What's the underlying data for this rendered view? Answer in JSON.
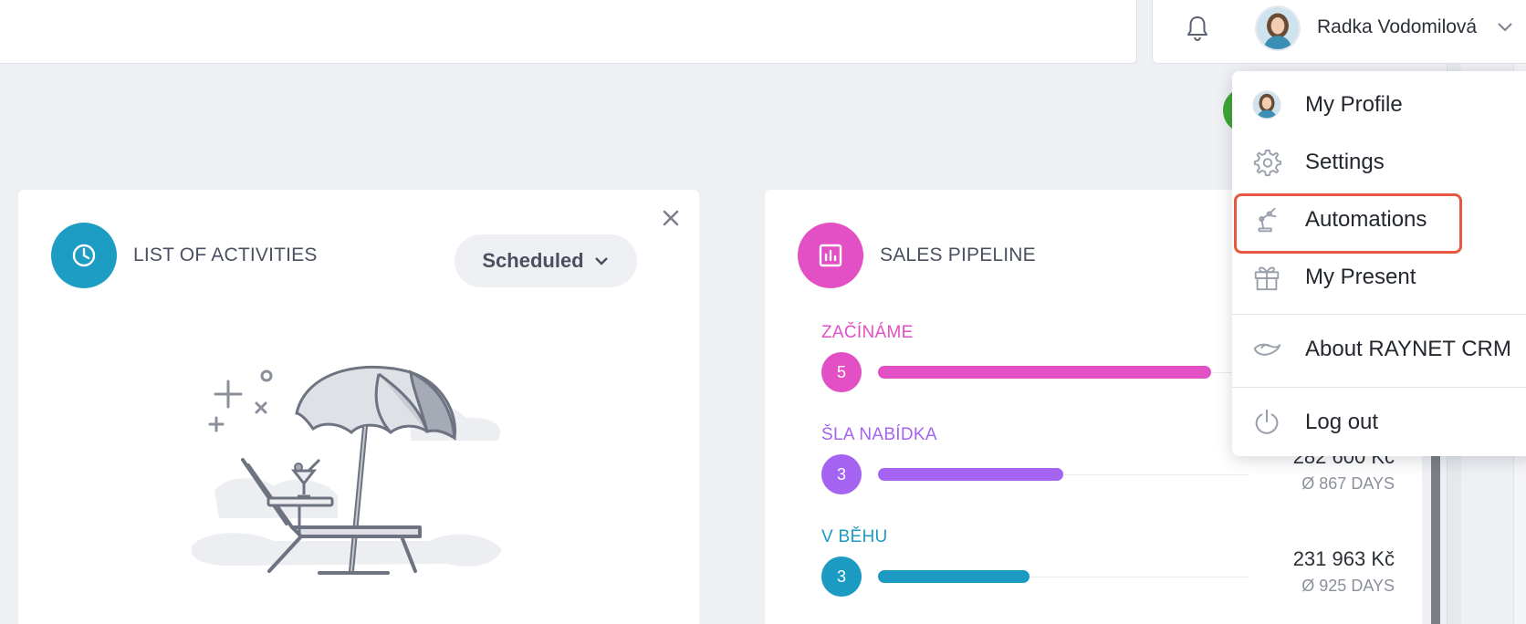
{
  "header": {
    "user_name": "Radka Vodomilová",
    "icons": [
      "bell-icon",
      "avatar",
      "chevron-down-icon"
    ]
  },
  "activities_card": {
    "title": "LIST OF ACTIVITIES",
    "filter_label": "Scheduled",
    "icon": "clock-icon",
    "accent": "#1d9cc4"
  },
  "pipeline_card": {
    "title": "SALES PIPELINE",
    "icon": "bar-chart-icon",
    "accent": "#e34fc4",
    "stages": [
      {
        "name": "ZAČÍNÁME",
        "count": "5",
        "color": "#e34fc4",
        "amount": "",
        "days": "",
        "fill": 0.9
      },
      {
        "name": "ŠLA NABÍDKA",
        "count": "3",
        "color": "#a463f0",
        "amount": "282 600 Kč",
        "days": "Ø 867 DAYS",
        "fill": 0.5
      },
      {
        "name": "V BĚHU",
        "count": "3",
        "color": "#1b9ac2",
        "amount": "231 963 Kč",
        "days": "Ø 925 DAYS",
        "fill": 0.41
      }
    ]
  },
  "user_menu": {
    "items": [
      {
        "label": "My Profile",
        "icon": "avatar"
      },
      {
        "label": "Settings",
        "icon": "gear-icon"
      },
      {
        "label": "Automations",
        "icon": "robot-arm-icon",
        "highlighted": true
      },
      {
        "label": "My Present",
        "icon": "gift-icon"
      },
      {
        "label": "About RAYNET CRM",
        "icon": "raynet-logo-icon"
      },
      {
        "label": "Log out",
        "icon": "power-icon"
      }
    ],
    "highlight_color": "#e8573f"
  }
}
